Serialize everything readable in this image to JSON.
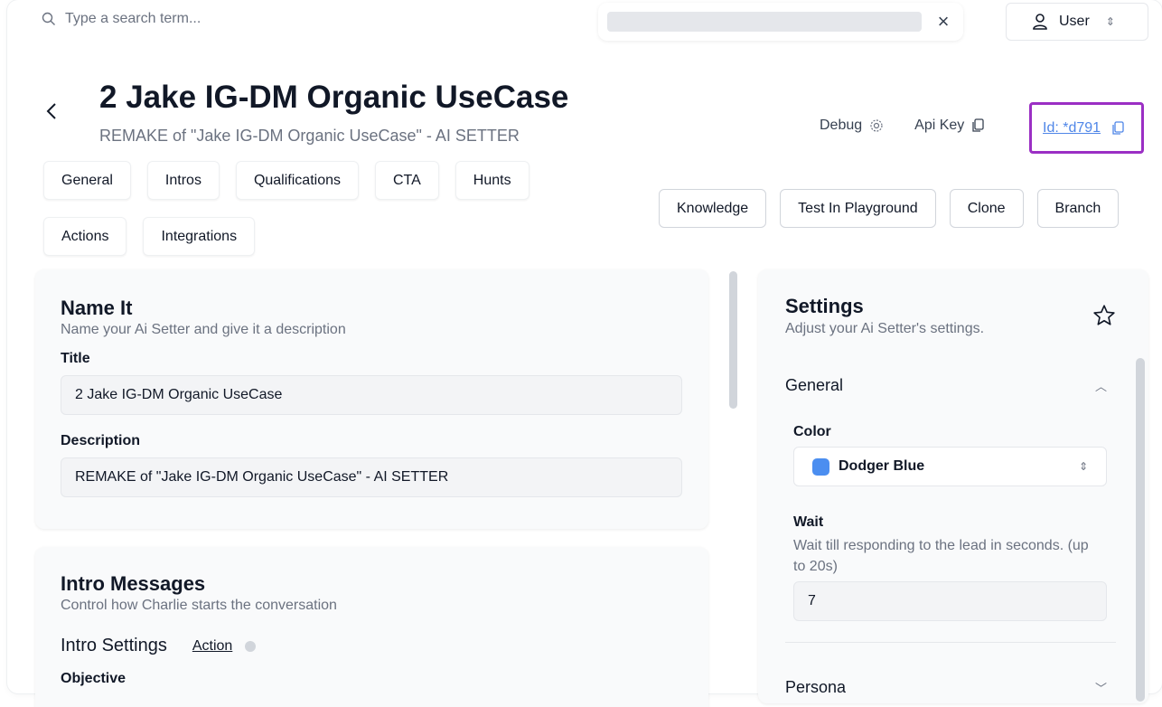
{
  "search": {
    "placeholder": "Type a search term..."
  },
  "user_menu": {
    "label": "User"
  },
  "header": {
    "title": "2 Jake IG-DM Organic UseCase",
    "subtitle": "REMAKE of \"Jake IG-DM Organic UseCase\" - AI SETTER",
    "debug_label": "Debug",
    "api_key_label": "Api Key",
    "id_label": "Id: *d791"
  },
  "tabs_row1": [
    "General",
    "Intros",
    "Qualifications",
    "CTA",
    "Hunts"
  ],
  "tabs_row2": [
    "Actions",
    "Integrations"
  ],
  "action_buttons": [
    "Knowledge",
    "Test In Playground",
    "Clone",
    "Branch"
  ],
  "name_card": {
    "title": "Name It",
    "description": "Name your Ai Setter and give it a description",
    "title_label": "Title",
    "title_value": "2 Jake IG-DM Organic UseCase",
    "description_label": "Description",
    "description_value": "REMAKE of \"Jake IG-DM Organic UseCase\" - AI SETTER"
  },
  "intro_card": {
    "title": "Intro Messages",
    "description": "Control how Charlie starts the conversation",
    "settings_label": "Intro Settings",
    "action_link": "Action",
    "objective_label": "Objective"
  },
  "settings_card": {
    "title": "Settings",
    "description": "Adjust your Ai Setter's settings.",
    "general_label": "General",
    "color_label": "Color",
    "color_value": "Dodger Blue",
    "color_swatch": "#4b8ef0",
    "wait_label": "Wait",
    "wait_help": "Wait till responding to the lead in seconds. (up to 20s)",
    "wait_value": "7",
    "persona_label": "Persona"
  },
  "colors": {
    "accent_border": "#9b2fc4",
    "link": "#4f86e8"
  }
}
